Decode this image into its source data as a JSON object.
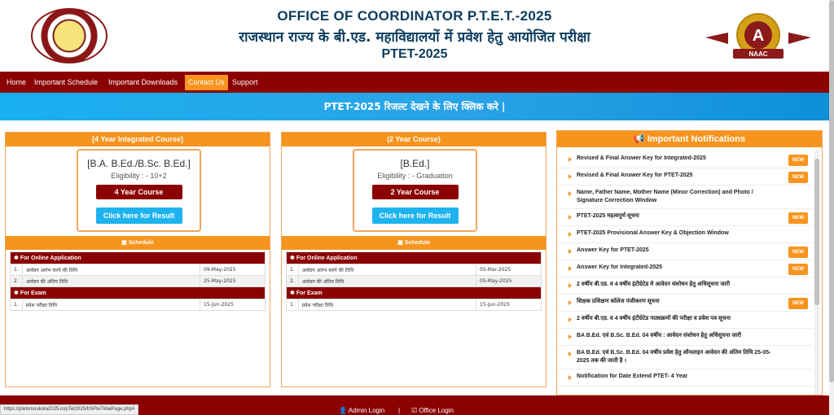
{
  "header": {
    "title_en": "OFFICE OF COORDINATOR P.T.E.T.-2025",
    "title_hi": "राजस्थान राज्य के बी.एड. महाविद्यालयों में प्रवेश हेतु आयोजित परीक्षा",
    "subtitle": "PTET-2025",
    "right_logo_letter": "A",
    "right_logo_text": "NAAC"
  },
  "nav": {
    "items": [
      "Home",
      "Important Schedule",
      "Important Downloads",
      "Contact Us",
      "Support"
    ],
    "active": "Contact Us"
  },
  "banner": {
    "text": "PTET-2025 रिजल्ट देखने के लिए क्लिक करे |"
  },
  "courses": [
    {
      "panel_title": "[4 Year Integrated Course]",
      "course_name": "[B.A. B.Ed./B.Sc. B.Ed.]",
      "eligibility": "Eligibility : - 10+2",
      "course_button": "4 Year Course",
      "result_button": "Click here for Result",
      "schedule_title": "Schedule",
      "online_label": "For Online Application",
      "online_rows": [
        {
          "num": "1.",
          "label": "आवेदन आरंभ करने की तिथि",
          "date": "09-May-2025"
        },
        {
          "num": "2.",
          "label": "आवेदन की अंतिम तिथि",
          "date": "25-May-2025"
        }
      ],
      "exam_label": "For Exam",
      "exam_rows": [
        {
          "num": "1.",
          "label": "प्रवेश परीक्षा तिथि",
          "date": "15-Jun-2025"
        }
      ]
    },
    {
      "panel_title": "(2 Year Course)",
      "course_name": "[B.Ed.]",
      "eligibility": "Eligibility : - Graduation",
      "course_button": "2 Year Course",
      "result_button": "Click here for Result",
      "schedule_title": "Schedule",
      "online_label": "For Online Application",
      "online_rows": [
        {
          "num": "1.",
          "label": "आवेदन आरंभ करने की तिथि",
          "date": "05-Mar-2025"
        },
        {
          "num": "2.",
          "label": "आवेदन की अंतिम तिथि",
          "date": "05-May-2025"
        }
      ],
      "exam_label": "For Exam",
      "exam_rows": [
        {
          "num": "1.",
          "label": "प्रवेश परीक्षा तिथि",
          "date": "15-Jun-2025"
        }
      ]
    }
  ],
  "notifications": {
    "title": "Important Notifications",
    "badge_text": "NEW",
    "items": [
      {
        "text": "Revised & Final Answer Key for Integrated-2025",
        "new": true
      },
      {
        "text": "Revised & Final Answer Key for PTET-2025",
        "new": true
      },
      {
        "text": "Name, Father Name, Mother Name (Minor Correction) and Photo / Signature Correction Window",
        "new": false
      },
      {
        "text": "PTET-2025 महत्वपूर्ण सूचना",
        "new": true
      },
      {
        "text": "PTET-2025 Provisional Answer Key & Objection Window",
        "new": false
      },
      {
        "text": "Answer Key for PTET-2025",
        "new": true
      },
      {
        "text": "Answer Key for Integrated-2025",
        "new": true
      },
      {
        "text": "2 वर्षीय बी.एड. व 4 वर्षीय इंटीग्रेटेड मे आवेदन संशोधन हेतु अधिसूचना जारी",
        "new": false
      },
      {
        "text": "शिक्षक प्रशिक्षण कॉलेज पंजीकरण सूचना",
        "new": true
      },
      {
        "text": "2 वर्षीय बी.एड. व 4 वर्षीय इंटीग्रेटेड पाठ्यक्रमों की परीक्षा व प्रवेश पत्र सूचना",
        "new": false
      },
      {
        "text": "BA B.Ed. एवं B.Sc. B.Ed. 04 वर्षीय : आवेदन संशोधन हेतु अधिसूचना जारी",
        "new": false
      },
      {
        "text": "BA B.Ed. एवं B.Sc. B.Ed. 04 वर्षीय प्रवेश हेतु ऑनलाइन आवेदन की अंतिम तिथि 25-05-2025 तक की जाती है ।",
        "new": false
      },
      {
        "text": "Notification for Date Extend PTET- 4 Year",
        "new": false
      }
    ]
  },
  "footer": {
    "admin_login": "Admin Login",
    "separator": "|",
    "office_login": "Office Login"
  },
  "status_url": "https://ptetvmoukota2025.in/pTet2025/hSPteTMaiPage.php#"
}
